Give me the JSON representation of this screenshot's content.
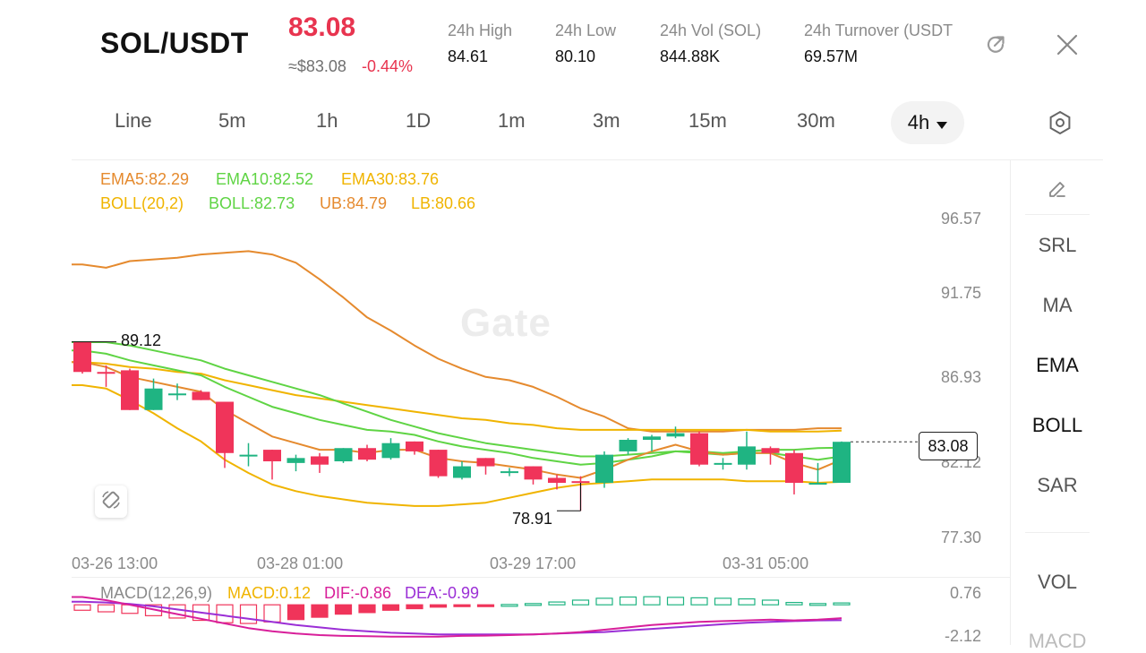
{
  "header": {
    "pair": "SOL/USDT",
    "last_price": "83.08",
    "approx_usd": "≈$83.08",
    "change_pct": "-0.44%",
    "stats": [
      {
        "label": "24h   High",
        "value": "84.61"
      },
      {
        "label": "24h   Low",
        "value": "80.10"
      },
      {
        "label": "24h   Vol (SOL)",
        "value": "844.88K"
      },
      {
        "label": "24h   Turnover (USDT",
        "value": "69.57M"
      }
    ],
    "share_icon": "share-icon",
    "close_icon": "close-icon"
  },
  "timeframes": {
    "items": [
      "Line",
      "5m",
      "1h",
      "1D",
      "1m",
      "3m",
      "15m",
      "30m"
    ],
    "active": "4h",
    "settings_icon": "settings-hexagon-icon"
  },
  "legend": {
    "ema5": "EMA5:82.29",
    "ema10": "EMA10:82.52",
    "ema30": "EMA30:83.76",
    "boll_params": "BOLL(20,2)",
    "boll": "BOLL:82.73",
    "ub": "UB:84.79",
    "lb": "LB:80.66"
  },
  "colors": {
    "up": "#1fb482",
    "down": "#f0345a",
    "ema5": "#e58a2e",
    "ema10": "#5fd444",
    "ema30": "#f0b400",
    "macd_dif": "#d81f9a",
    "macd_dea": "#9b2fd6"
  },
  "y_axis": [
    "96.57",
    "91.75",
    "86.93",
    "82.12",
    "77.30"
  ],
  "x_axis": [
    "03-26 13:00",
    "03-28 01:00",
    "03-29 17:00",
    "03-31 05:00"
  ],
  "markers": {
    "high": "89.12",
    "low": "78.91",
    "current": "83.08"
  },
  "watermark": "Gate",
  "sidebar": {
    "edit_icon": "pencil-icon",
    "items": [
      "SRL",
      "MA",
      "EMA",
      "BOLL",
      "SAR"
    ],
    "sub_items": [
      "VOL",
      "MACD"
    ]
  },
  "macd": {
    "label": "MACD(12,26,9)",
    "macd": "MACD:0.12",
    "dif": "DIF:-0.86",
    "dea": "DEA:-0.99",
    "y_top": "0.76",
    "y_bottom": "-2.12"
  },
  "chart_data": {
    "type": "candlestick",
    "interval": "4h",
    "ylim": [
      77.3,
      96.57
    ],
    "candles": [
      {
        "o": 89.1,
        "h": 89.1,
        "l": 87.2,
        "c": 87.3
      },
      {
        "o": 87.3,
        "h": 87.7,
        "l": 86.4,
        "c": 87.2
      },
      {
        "o": 87.4,
        "h": 87.5,
        "l": 85.0,
        "c": 85.0
      },
      {
        "o": 85.0,
        "h": 86.9,
        "l": 85.0,
        "c": 86.3
      },
      {
        "o": 86.0,
        "h": 86.6,
        "l": 85.6,
        "c": 86.0
      },
      {
        "o": 86.1,
        "h": 86.2,
        "l": 85.6,
        "c": 85.6
      },
      {
        "o": 85.5,
        "h": 85.5,
        "l": 81.5,
        "c": 82.4
      },
      {
        "o": 82.2,
        "h": 83.0,
        "l": 81.6,
        "c": 82.3
      },
      {
        "o": 82.6,
        "h": 82.6,
        "l": 80.8,
        "c": 81.9
      },
      {
        "o": 81.8,
        "h": 82.3,
        "l": 81.3,
        "c": 82.1
      },
      {
        "o": 82.2,
        "h": 82.4,
        "l": 81.2,
        "c": 81.7
      },
      {
        "o": 81.9,
        "h": 82.7,
        "l": 81.8,
        "c": 82.7
      },
      {
        "o": 82.7,
        "h": 82.9,
        "l": 81.9,
        "c": 82.0
      },
      {
        "o": 82.1,
        "h": 83.3,
        "l": 82.0,
        "c": 83.0
      },
      {
        "o": 83.1,
        "h": 83.1,
        "l": 82.3,
        "c": 82.5
      },
      {
        "o": 82.6,
        "h": 82.6,
        "l": 80.9,
        "c": 81.0
      },
      {
        "o": 80.9,
        "h": 81.9,
        "l": 80.8,
        "c": 81.6
      },
      {
        "o": 82.1,
        "h": 82.1,
        "l": 81.1,
        "c": 81.6
      },
      {
        "o": 81.3,
        "h": 81.5,
        "l": 81.0,
        "c": 81.3
      },
      {
        "o": 81.6,
        "h": 81.6,
        "l": 80.5,
        "c": 80.8
      },
      {
        "o": 80.9,
        "h": 81.1,
        "l": 80.2,
        "c": 80.6
      },
      {
        "o": 80.7,
        "h": 81.0,
        "l": 78.91,
        "c": 80.6
      },
      {
        "o": 80.6,
        "h": 82.5,
        "l": 80.3,
        "c": 82.3
      },
      {
        "o": 82.5,
        "h": 83.3,
        "l": 82.3,
        "c": 83.2
      },
      {
        "o": 83.2,
        "h": 83.5,
        "l": 82.5,
        "c": 83.4
      },
      {
        "o": 83.4,
        "h": 84.0,
        "l": 83.3,
        "c": 83.6
      },
      {
        "o": 83.6,
        "h": 83.7,
        "l": 81.6,
        "c": 81.7
      },
      {
        "o": 81.7,
        "h": 82.1,
        "l": 81.4,
        "c": 81.8
      },
      {
        "o": 81.7,
        "h": 83.7,
        "l": 81.4,
        "c": 82.8
      },
      {
        "o": 82.7,
        "h": 82.8,
        "l": 81.7,
        "c": 82.4
      },
      {
        "o": 82.4,
        "h": 82.6,
        "l": 79.9,
        "c": 80.6
      },
      {
        "o": 80.6,
        "h": 81.8,
        "l": 80.5,
        "c": 80.6
      },
      {
        "o": 80.6,
        "h": 83.1,
        "l": 80.6,
        "c": 83.08
      }
    ],
    "ema5": [
      87.9,
      87.6,
      87.0,
      86.7,
      86.4,
      86.1,
      85.0,
      84.2,
      83.4,
      83.0,
      82.6,
      82.6,
      82.4,
      82.6,
      82.6,
      82.1,
      81.9,
      81.8,
      81.6,
      81.4,
      81.1,
      80.9,
      81.4,
      82.0,
      82.5,
      82.9,
      82.5,
      82.3,
      82.4,
      82.4,
      81.8,
      81.4,
      82.0
    ],
    "ema10": [
      88.6,
      88.4,
      88.0,
      87.7,
      87.4,
      87.1,
      86.4,
      85.8,
      85.2,
      84.8,
      84.4,
      84.1,
      83.8,
      83.7,
      83.5,
      83.1,
      82.8,
      82.6,
      82.4,
      82.1,
      81.9,
      81.7,
      81.8,
      82.0,
      82.2,
      82.5,
      82.4,
      82.3,
      82.4,
      82.4,
      82.2,
      82.0,
      82.2
    ],
    "ema30": [
      87.9,
      87.8,
      87.6,
      87.5,
      87.3,
      87.2,
      86.8,
      86.5,
      86.2,
      85.9,
      85.7,
      85.5,
      85.3,
      85.1,
      84.9,
      84.7,
      84.5,
      84.4,
      84.2,
      84.1,
      83.9,
      83.8,
      83.8,
      83.8,
      83.8,
      83.8,
      83.8,
      83.8,
      83.8,
      83.7,
      83.7,
      83.7,
      83.76
    ],
    "boll_ub": [
      93.8,
      93.6,
      94.0,
      94.1,
      94.2,
      94.4,
      94.5,
      94.6,
      94.4,
      93.9,
      92.9,
      91.8,
      90.6,
      89.8,
      88.9,
      88.1,
      87.5,
      87.0,
      86.8,
      86.4,
      85.8,
      85.1,
      84.6,
      83.9,
      83.7,
      83.7,
      83.7,
      83.7,
      83.8,
      83.8,
      83.8,
      83.9,
      83.9
    ],
    "boll_mid": [
      89.1,
      89.1,
      88.9,
      88.6,
      88.3,
      88.0,
      87.5,
      87.1,
      86.7,
      86.3,
      85.9,
      85.4,
      84.9,
      84.4,
      84.0,
      83.6,
      83.3,
      83.0,
      82.8,
      82.6,
      82.4,
      82.2,
      82.2,
      82.3,
      82.4,
      82.5,
      82.5,
      82.4,
      82.5,
      82.6,
      82.6,
      82.7,
      82.73
    ],
    "boll_lb": [
      86.5,
      86.3,
      85.6,
      84.8,
      83.9,
      83.1,
      82.0,
      81.2,
      80.5,
      80.1,
      79.8,
      79.6,
      79.4,
      79.3,
      79.2,
      79.2,
      79.3,
      79.4,
      79.7,
      80.0,
      80.3,
      80.5,
      80.6,
      80.7,
      80.8,
      80.8,
      80.8,
      80.8,
      80.7,
      80.7,
      80.7,
      80.6,
      80.66
    ],
    "macd_hist": [
      -0.35,
      -0.45,
      -0.55,
      -0.7,
      -0.85,
      -1.0,
      -1.15,
      -1.2,
      -1.1,
      -0.95,
      -0.8,
      -0.6,
      -0.5,
      -0.35,
      -0.25,
      -0.15,
      -0.08,
      -0.03,
      0.02,
      0.08,
      0.18,
      0.3,
      0.42,
      0.5,
      0.52,
      0.48,
      0.45,
      0.42,
      0.38,
      0.3,
      0.15,
      0.08,
      0.12
    ],
    "macd_dif": [
      0.5,
      0.3,
      0.0,
      -0.3,
      -0.6,
      -0.9,
      -1.2,
      -1.5,
      -1.7,
      -1.85,
      -1.95,
      -2.0,
      -2.02,
      -2.05,
      -2.05,
      -2.05,
      -2.0,
      -1.98,
      -1.95,
      -1.9,
      -1.85,
      -1.75,
      -1.6,
      -1.45,
      -1.3,
      -1.2,
      -1.1,
      -1.05,
      -1.0,
      -0.95,
      -1.0,
      -0.95,
      -0.86
    ],
    "macd_dea": [
      0.2,
      0.15,
      0.05,
      -0.1,
      -0.3,
      -0.5,
      -0.7,
      -0.9,
      -1.1,
      -1.3,
      -1.45,
      -1.6,
      -1.7,
      -1.8,
      -1.85,
      -1.9,
      -1.9,
      -1.9,
      -1.9,
      -1.9,
      -1.85,
      -1.8,
      -1.75,
      -1.65,
      -1.55,
      -1.45,
      -1.35,
      -1.25,
      -1.15,
      -1.1,
      -1.05,
      -1.0,
      -0.99
    ],
    "macd_ylim": [
      -2.12,
      0.76
    ]
  }
}
